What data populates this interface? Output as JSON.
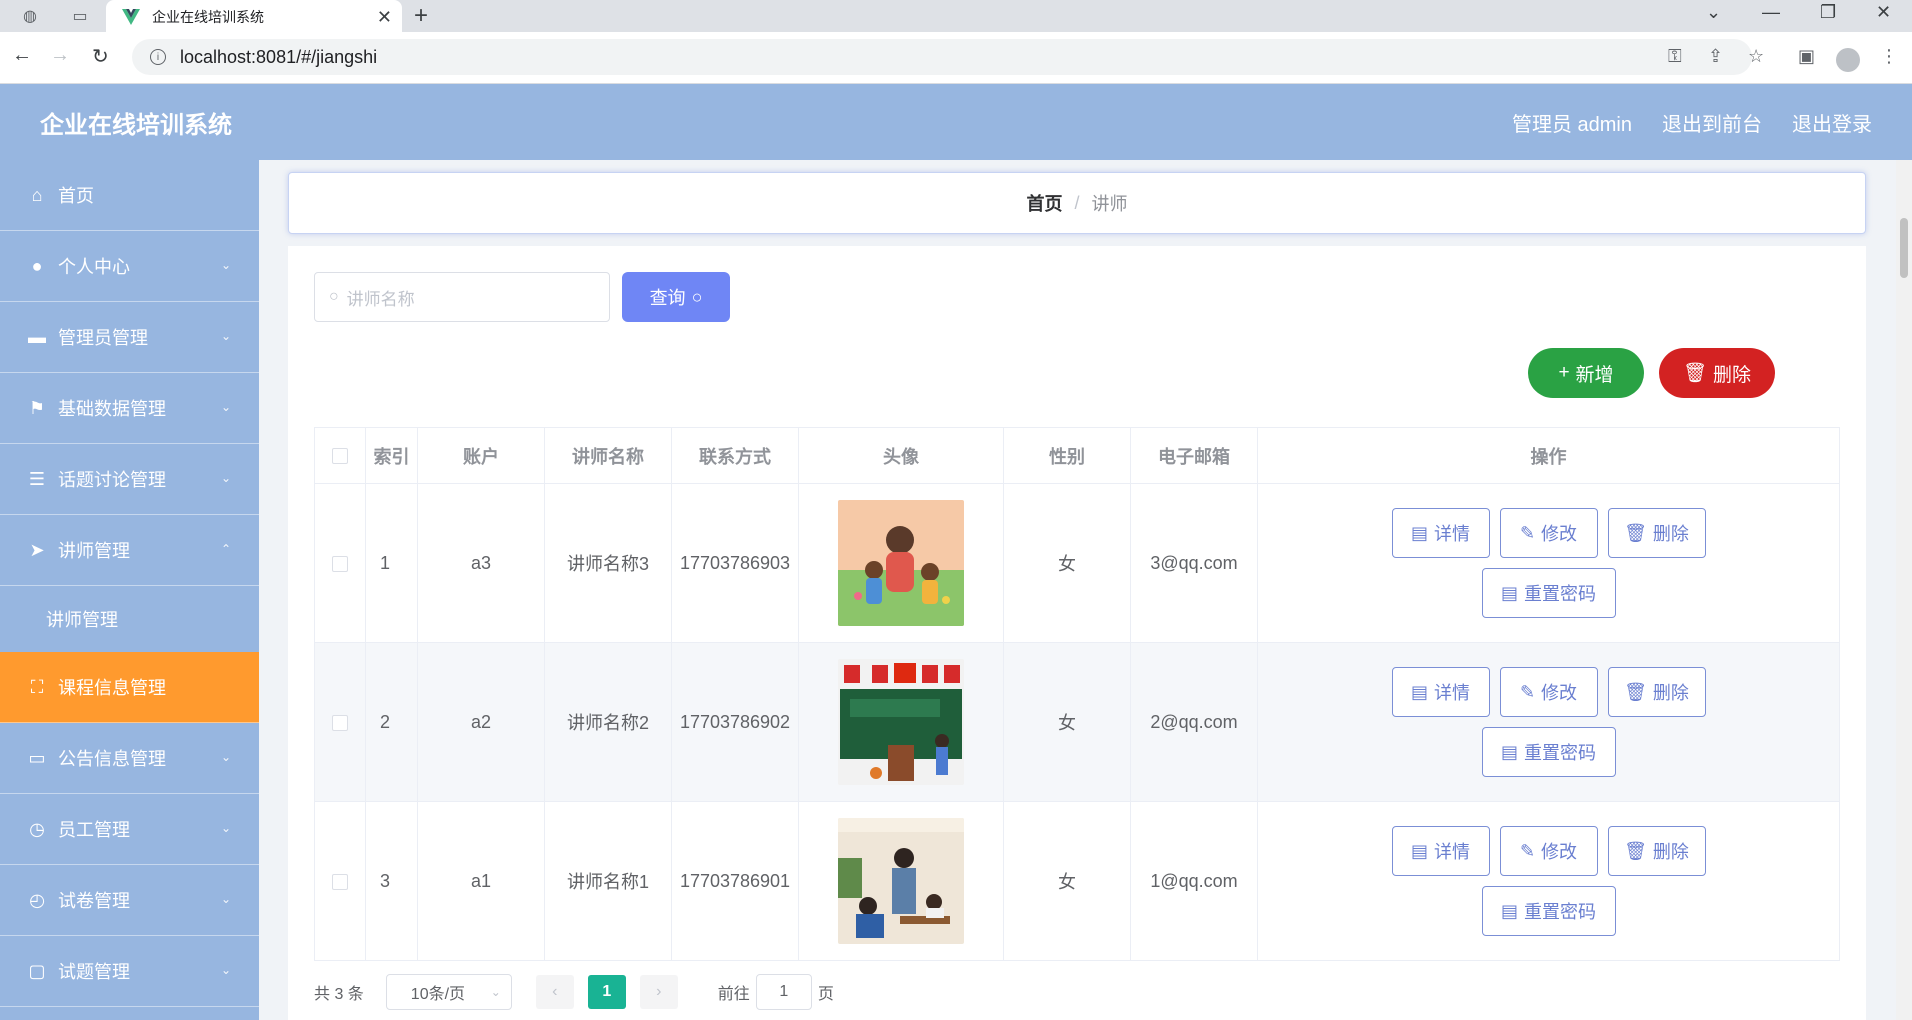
{
  "browser": {
    "tab_title": "企业在线培训系统",
    "url": "localhost:8081/#/jiangshi"
  },
  "header": {
    "app_title": "企业在线培训系统",
    "user": "管理员 admin",
    "to_front": "退出到前台",
    "logout": "退出登录"
  },
  "sidebar": {
    "items": [
      {
        "label": "首页",
        "icon": "home-icon"
      },
      {
        "label": "个人中心",
        "icon": "user-icon"
      },
      {
        "label": "管理员管理",
        "icon": "briefcase-icon"
      },
      {
        "label": "基础数据管理",
        "icon": "flag-icon"
      },
      {
        "label": "话题讨论管理",
        "icon": "sliders-icon"
      },
      {
        "label": "讲师管理",
        "icon": "send-icon"
      },
      {
        "label": "讲师管理",
        "icon": ""
      },
      {
        "label": "课程信息管理",
        "icon": "fullscreen-icon"
      },
      {
        "label": "公告信息管理",
        "icon": "monitor-icon"
      },
      {
        "label": "员工管理",
        "icon": "clock-icon"
      },
      {
        "label": "试卷管理",
        "icon": "compass-icon"
      },
      {
        "label": "试题管理",
        "icon": "chat-icon"
      }
    ]
  },
  "breadcrumb": {
    "home": "首页",
    "current": "讲师"
  },
  "search": {
    "placeholder": "讲师名称",
    "button": "查询"
  },
  "actions": {
    "add": "新增",
    "delete": "删除"
  },
  "table": {
    "columns": [
      "索引",
      "账户",
      "讲师名称",
      "联系方式",
      "头像",
      "性别",
      "电子邮箱",
      "操作"
    ],
    "rows": [
      {
        "index": "1",
        "account": "a3",
        "name": "讲师名称3",
        "phone": "17703786903",
        "gender": "女",
        "email": "3@qq.com"
      },
      {
        "index": "2",
        "account": "a2",
        "name": "讲师名称2",
        "phone": "17703786902",
        "gender": "女",
        "email": "2@qq.com"
      },
      {
        "index": "3",
        "account": "a1",
        "name": "讲师名称1",
        "phone": "17703786901",
        "gender": "女",
        "email": "1@qq.com"
      }
    ],
    "ops": {
      "detail": "详情",
      "edit": "修改",
      "delete": "删除",
      "reset": "重置密码"
    }
  },
  "pagination": {
    "total": "共 3 条",
    "page_size": "10条/页",
    "current": "1",
    "goto_prefix": "前往",
    "goto_value": "1",
    "goto_suffix": "页"
  },
  "colors": {
    "header_bg": "#97b6e0",
    "active_menu": "#ff9a2e",
    "query_btn": "#6f86f5",
    "add_btn": "#2aa244",
    "delete_btn": "#d32222",
    "current_page": "#19b394"
  }
}
